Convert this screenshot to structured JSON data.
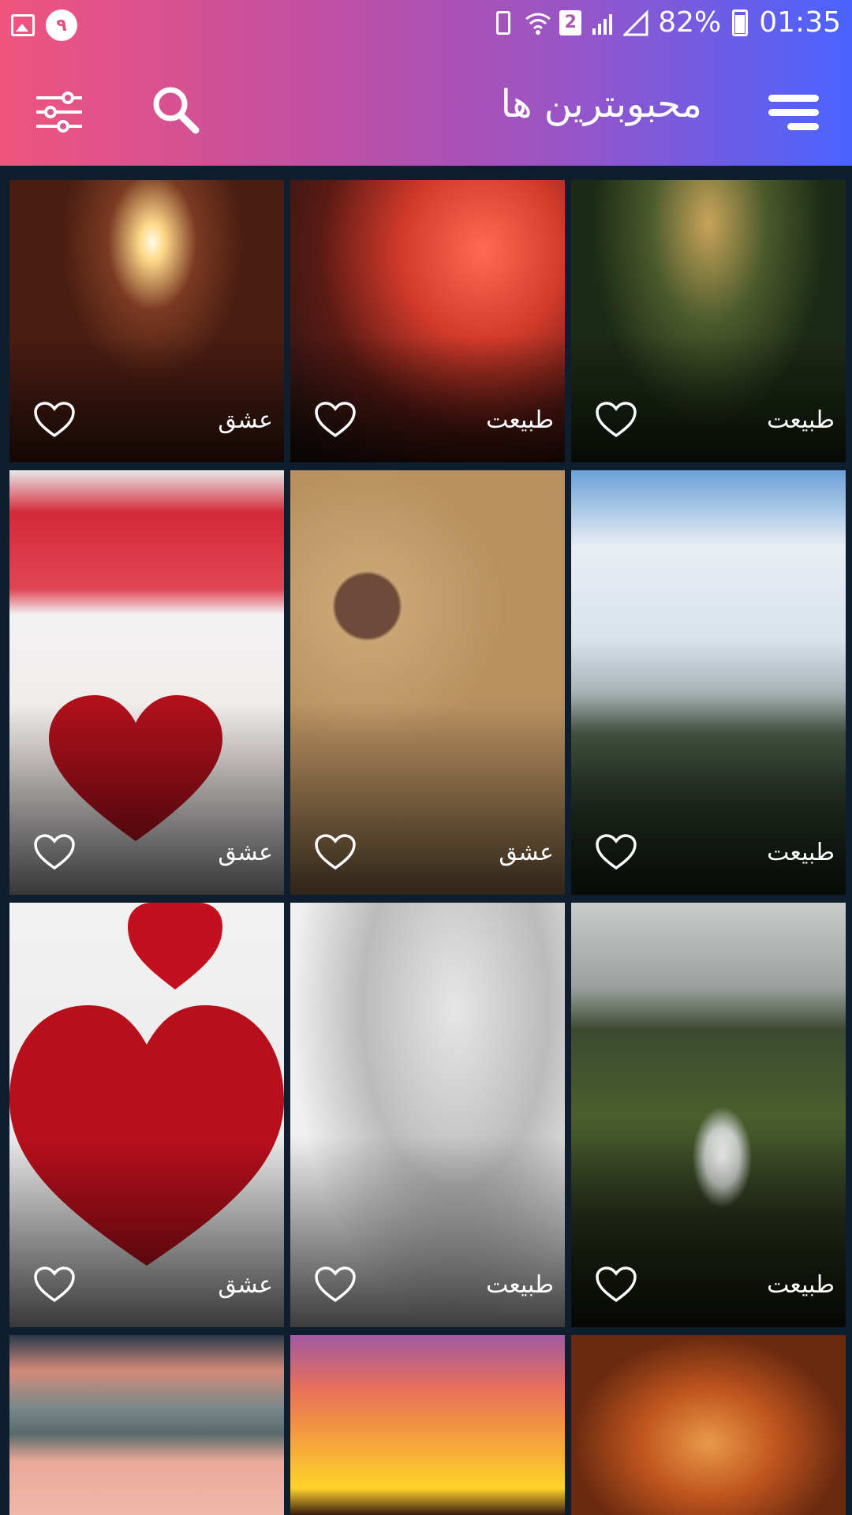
{
  "status_bar": {
    "notification_badge": "۹",
    "sim_slot": "2",
    "battery_percent": "82%",
    "time": "01:35"
  },
  "toolbar": {
    "title": "محبوبترین ها",
    "icons": [
      "menu-icon",
      "search-icon",
      "filter-sliders-icon"
    ]
  },
  "colors": {
    "header_gradient": [
      "#f0547d",
      "#c44fa0",
      "#9b54c4",
      "#4a63ff"
    ],
    "background": "#0f1e2e"
  },
  "wallpapers": [
    {
      "category": "عشق"
    },
    {
      "category": "طبیعت"
    },
    {
      "category": "طبیعت"
    },
    {
      "category": "عشق"
    },
    {
      "category": "عشق"
    },
    {
      "category": "طبیعت"
    },
    {
      "category": "عشق"
    },
    {
      "category": "طبیعت"
    },
    {
      "category": "طبیعت"
    },
    {
      "category": ""
    },
    {
      "category": ""
    },
    {
      "category": ""
    }
  ]
}
